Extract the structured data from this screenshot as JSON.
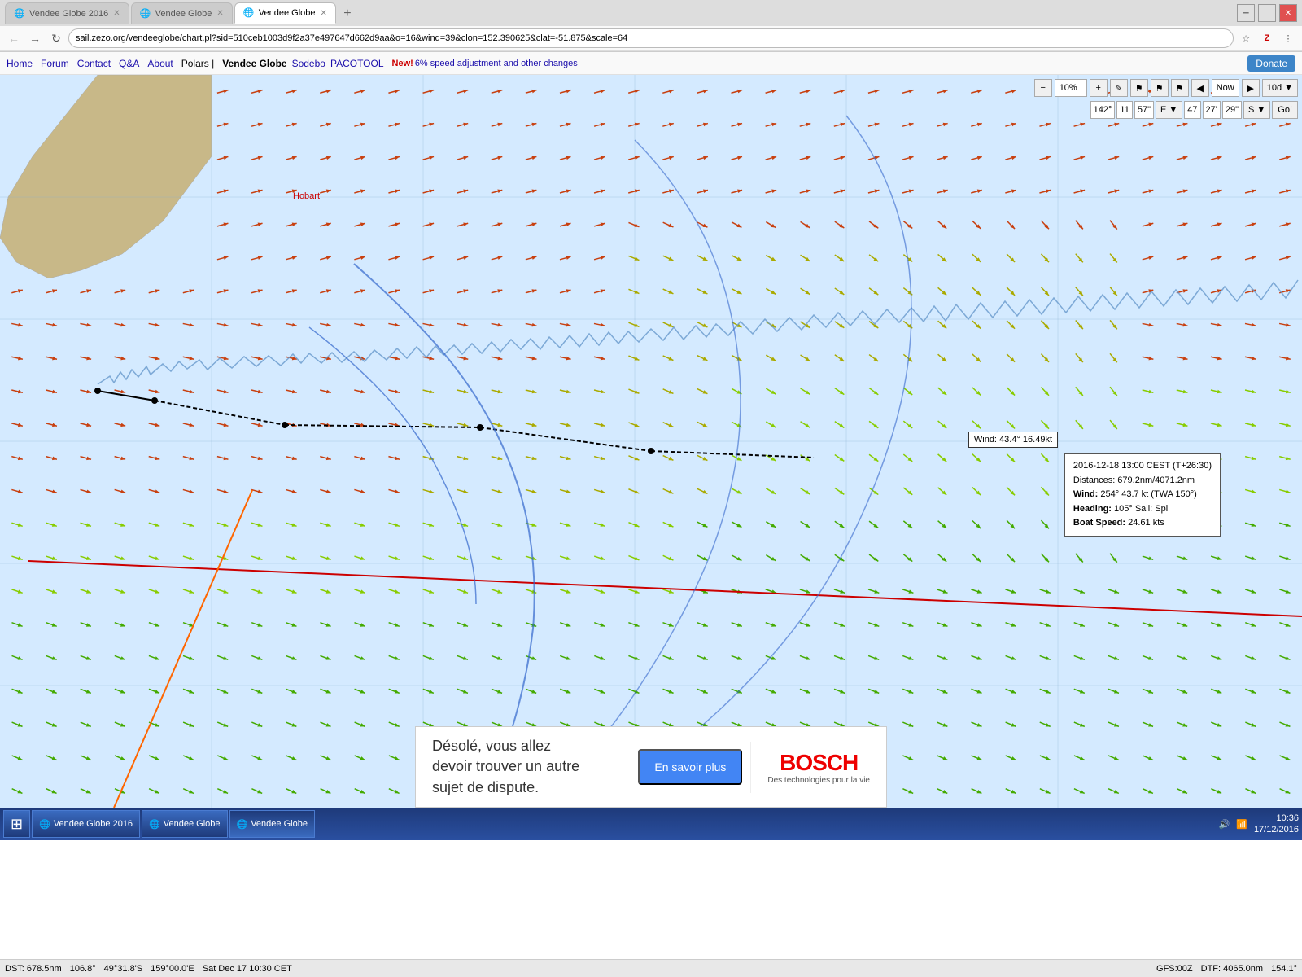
{
  "browser": {
    "tabs": [
      {
        "label": "Vendee Globe 2016",
        "active": false,
        "favicon_char": "🌐"
      },
      {
        "label": "Vendee Globe",
        "active": false,
        "favicon_char": "🌐"
      },
      {
        "label": "Vendee Globe",
        "active": true,
        "favicon_char": "🌐"
      }
    ],
    "address": "sail.zezo.org/vendeeglobe/chart.pl?sid=510ceb1003d9f2a37e497647d662d9aa&o=16&wind=39&clon=152.390625&clat=-51.875&scale=64",
    "window_controls": [
      "─",
      "□",
      "✕"
    ]
  },
  "nav": {
    "links": [
      "Home",
      "Forum",
      "Contact",
      "Q&A",
      "About",
      "Polars |"
    ],
    "brand": "Vendee Globe",
    "external_links": [
      "Sodebo",
      "PACOTOOL"
    ],
    "news_label": "New!",
    "news_text": "6% speed adjustment and other changes",
    "donate_label": "Donate"
  },
  "map_toolbar": {
    "minus_label": "−",
    "zoom_value": "10%",
    "plus_label": "+",
    "pencil_label": "✎",
    "flag_labels": [
      "⚑",
      "⚑",
      "⚑"
    ],
    "arrow_left": "◀",
    "time_label": "Now",
    "arrow_right": "▶",
    "days_label": "10d ▼"
  },
  "coord_toolbar": {
    "deg1": "142°",
    "min1": "11",
    "sec1": "57\"",
    "dir1": "E ▼",
    "deg2": "47",
    "min2": "27'",
    "sec2": "29\"",
    "dir2": "S ▼",
    "go_label": "Go!"
  },
  "tooltips": {
    "wind_label": "Wind: 43.4° 16.49kt",
    "detail_date": "2016-12-18 13:00 CEST (T+26:30)",
    "detail_distances": "Distances: 679.2nm/4071.2nm",
    "detail_wind_label": "Wind:",
    "detail_wind_value": "254° 43.7 kt (TWA 150°)",
    "detail_heading_label": "Heading:",
    "detail_heading_value": "105° Sail: Spi",
    "detail_speed_label": "Boat Speed:",
    "detail_speed_value": "24.61 kts"
  },
  "ad": {
    "text": "Désolé, vous allez\ndevoir trouver un autre\nsujet de dispute.",
    "cta_label": "En savoir plus",
    "logo_text": "BOSCH",
    "logo_sub": "Des technologies pour la vie"
  },
  "status_bar": {
    "dst": "DST: 678.5nm",
    "heading": "106.8°",
    "lat": "49°31.8'S",
    "lon": "159°00.0'E",
    "datetime": "Sat Dec 17 10:30 CET",
    "gfs": "GFS:00Z",
    "dtf": "DTF: 4065.0nm",
    "bearing": "154.1°"
  },
  "taskbar": {
    "start_icon": "⊞",
    "apps": [
      {
        "label": "Vendee Globe 2016",
        "icon": "🌐"
      },
      {
        "label": "Vendee Globe",
        "icon": "🌐"
      },
      {
        "label": "Vendee Globe",
        "icon": "🌐",
        "active": true
      }
    ],
    "clock_time": "10:36",
    "clock_date": "17/12/2016"
  },
  "map": {
    "land_color": "#c8b888",
    "sea_color": "#d4eaff",
    "hobart_label": "Hobart"
  }
}
